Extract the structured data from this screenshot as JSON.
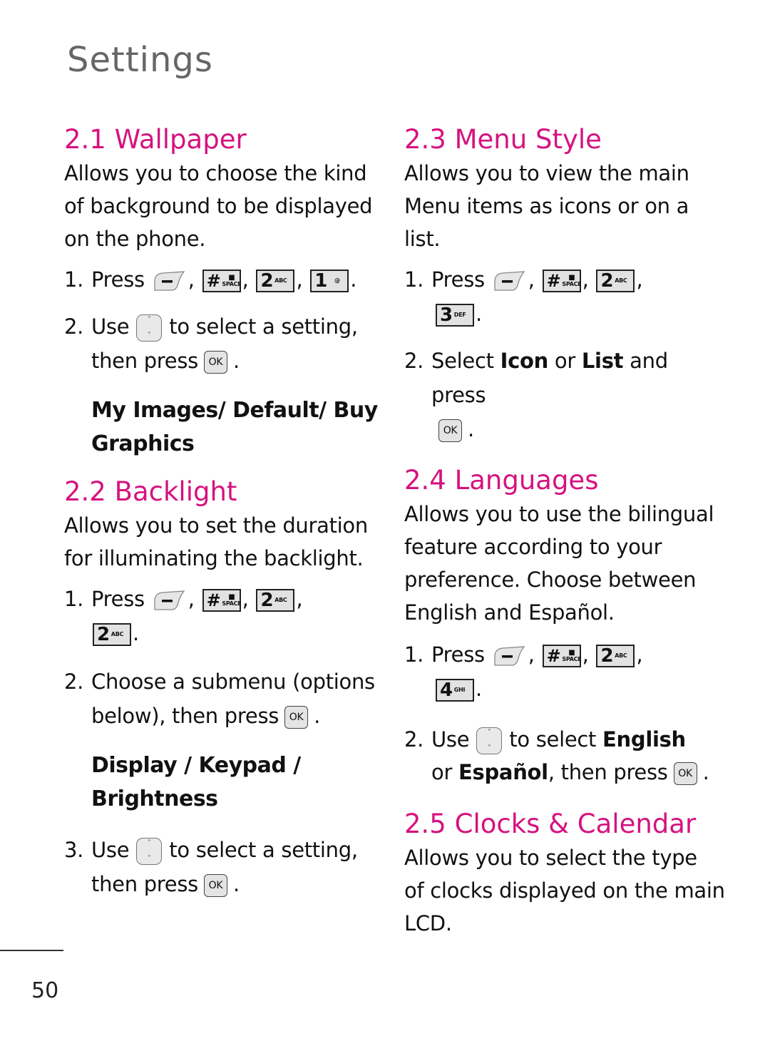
{
  "page": {
    "title": "Settings",
    "number": "50",
    "accent_color": "#d6127f"
  },
  "keys": {
    "soft_key": "left-soft-key-icon",
    "hash": {
      "main": "#",
      "sub": "SPACE",
      "glyph": "🔒"
    },
    "k1": {
      "main": "1",
      "sub": "@"
    },
    "k2": {
      "main": "2",
      "sub": "ABC"
    },
    "k3": {
      "main": "3",
      "sub": "DEF"
    },
    "k4": {
      "main": "4",
      "sub": "GHI"
    },
    "ok": "OK",
    "nav_up": "˄",
    "nav_down": "˅"
  },
  "sections": {
    "wallpaper": {
      "heading": "2.1 Wallpaper",
      "desc": [
        "Allows you to choose the kind",
        "of background to be displayed",
        "on the phone."
      ],
      "step1": {
        "num": "1.",
        "text": "Press"
      },
      "step2": {
        "num": "2.",
        "pre": "Use",
        "mid": "to select a setting,",
        "line2": "then press"
      },
      "options": [
        "My Images/ Default/ Buy",
        "Graphics"
      ]
    },
    "backlight": {
      "heading": "2.2 Backlight",
      "desc": [
        "Allows you to set the duration",
        "for illuminating the backlight."
      ],
      "step1": {
        "num": "1.",
        "text": "Press"
      },
      "step2": {
        "num": "2.",
        "line1": "Choose a submenu (options",
        "line2": "below), then press"
      },
      "options": [
        "Display / Keypad /",
        "Brightness"
      ],
      "step3": {
        "num": "3.",
        "pre": "Use",
        "mid": "to select a setting,",
        "line2": "then press"
      }
    },
    "menu_style": {
      "heading": "2.3 Menu Style",
      "desc": [
        "Allows you to view the main",
        "Menu items as icons or on a",
        "list."
      ],
      "step1": {
        "num": "1.",
        "text": "Press"
      },
      "step2": {
        "num": "2.",
        "pre": "Select",
        "kw1": "Icon",
        "or": "or",
        "kw2": "List",
        "post": "and press"
      }
    },
    "languages": {
      "heading": "2.4 Languages",
      "desc": [
        "Allows you to use the bilingual",
        "feature according to your",
        "preference. Choose between",
        "English and Español."
      ],
      "step1": {
        "num": "1.",
        "text": "Press"
      },
      "step2": {
        "num": "2.",
        "pre": "Use",
        "mid": "to select",
        "kw1": "English",
        "or": "or",
        "kw2": "Español",
        "post": ", then press"
      }
    },
    "clocks": {
      "heading": "2.5 Clocks & Calendar",
      "desc": [
        "Allows you to select the type",
        "of clocks displayed on the main",
        "LCD."
      ]
    }
  },
  "punct": {
    "comma": ",",
    "period": "."
  }
}
